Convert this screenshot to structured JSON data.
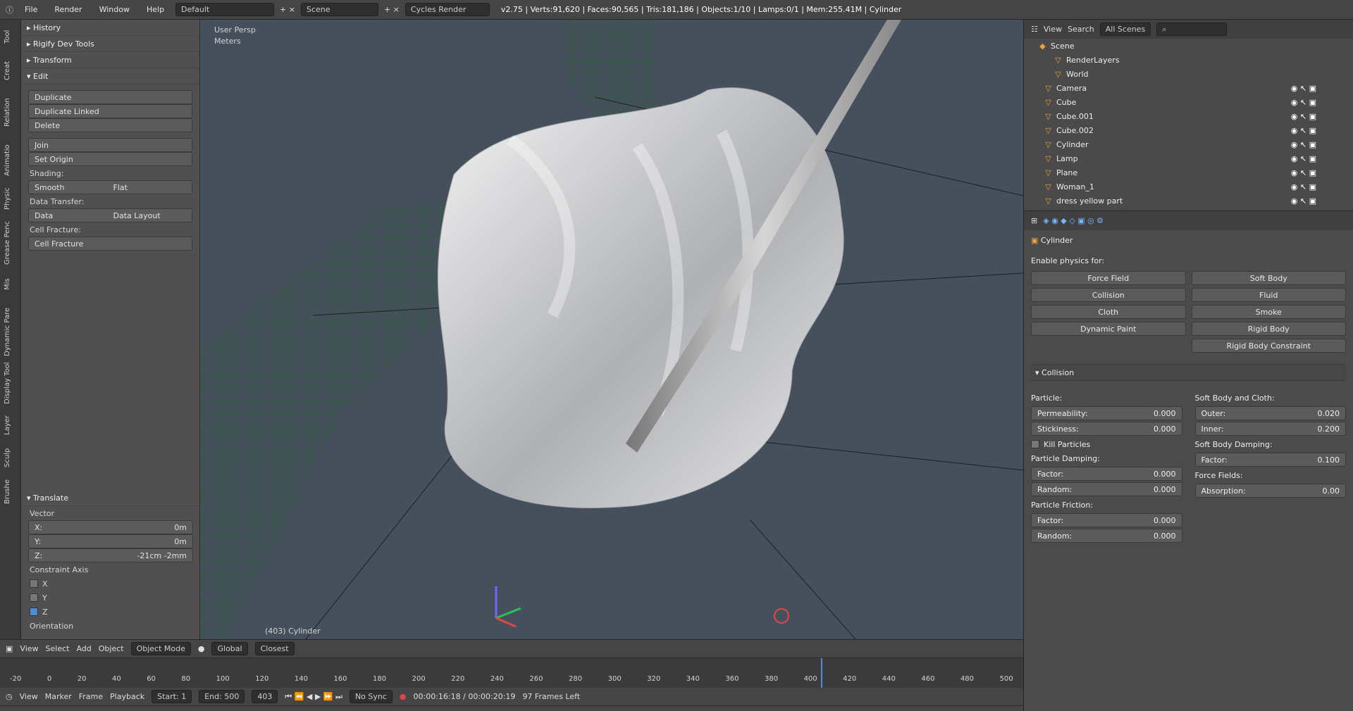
{
  "top": {
    "menus": [
      "File",
      "Render",
      "Window",
      "Help"
    ],
    "layout": "Default",
    "scene": "Scene",
    "engine": "Cycles Render",
    "stats": "v2.75 | Verts:91,620 | Faces:90,565 | Tris:181,186 | Objects:1/10 | Lamps:0/1 | Mem:255.41M | Cylinder"
  },
  "vtabs": [
    "Tool",
    "Creat",
    "Relation",
    "Animatio",
    "Physic",
    "Grease Penc",
    "Mis",
    "Dynamic Pare",
    "Display Tool",
    "Layer",
    "Sculp",
    "Brushe"
  ],
  "tool": {
    "history": "History",
    "rigify": "Rigify Dev Tools",
    "transform": "Transform",
    "edit": "Edit",
    "buttons": [
      "Duplicate",
      "Duplicate Linked",
      "Delete",
      "Join",
      "Set Origin"
    ],
    "shading": "Shading:",
    "smooth": "Smooth",
    "flat": "Flat",
    "data_transfer": "Data Transfer:",
    "data": "Data",
    "data_layout": "Data Layout",
    "cell_fracture_label": "Cell Fracture:",
    "cell_fracture": "Cell Fracture",
    "translate": "Translate",
    "vector": "Vector",
    "x": "X:",
    "y": "Y:",
    "z": "Z:",
    "xv": "0m",
    "yv": "0m",
    "zv": "-21cm -2mm",
    "constraint": "Constraint Axis",
    "axes": [
      "X",
      "Y",
      "Z"
    ],
    "orientation": "Orientation"
  },
  "viewport": {
    "persp": "User Persp",
    "units": "Meters",
    "object": "(403) Cylinder"
  },
  "view_header": [
    "View",
    "Select",
    "Add",
    "Object",
    "Object Mode",
    "Global",
    "Closest"
  ],
  "timeline": {
    "menus": [
      "View",
      "Marker",
      "Frame",
      "Playback"
    ],
    "start_label": "Start:",
    "start": "1",
    "end_label": "End:",
    "end": "500",
    "frame": "403",
    "sync": "No Sync",
    "time": "00:00:16:18 / 00:00:20:19",
    "frames_left": "97 Frames Left",
    "ticks": [
      "-20",
      "0",
      "20",
      "40",
      "60",
      "80",
      "100",
      "120",
      "140",
      "160",
      "180",
      "200",
      "220",
      "240",
      "260",
      "280",
      "300",
      "320",
      "340",
      "360",
      "380",
      "400",
      "420",
      "440",
      "460",
      "480",
      "500"
    ]
  },
  "outliner": {
    "view": "View",
    "search": "Search",
    "all_scenes": "All Scenes",
    "items": [
      "Scene",
      "RenderLayers",
      "World",
      "Camera",
      "Cube",
      "Cube.001",
      "Cube.002",
      "Cylinder",
      "Lamp",
      "Plane",
      "Woman_1",
      "dress yellow part"
    ]
  },
  "props": {
    "object": "Cylinder",
    "enable": "Enable physics for:",
    "buttons": [
      "Force Field",
      "Soft Body",
      "Collision",
      "Fluid",
      "Cloth",
      "Smoke",
      "Dynamic Paint",
      "Rigid Body",
      "",
      "Rigid Body Constraint"
    ],
    "collision": "Collision",
    "particle": "Particle:",
    "permeability": "Permeability:",
    "perm_v": "0.000",
    "stickiness": "Stickiness:",
    "stick_v": "0.000",
    "kill": "Kill Particles",
    "damping": "Particle Damping:",
    "factor": "Factor:",
    "factor_v": "0.000",
    "random": "Random:",
    "random_v": "0.000",
    "friction": "Particle Friction:",
    "ffactor_v": "0.000",
    "frandom_v": "0.000",
    "soft": "Soft Body and Cloth:",
    "outer": "Outer:",
    "outer_v": "0.020",
    "inner": "Inner:",
    "inner_v": "0.200",
    "sbd": "Soft Body Damping:",
    "sbd_factor_v": "0.100",
    "force_fields": "Force Fields:",
    "absorption": "Absorption:",
    "absorption_v": "0.00"
  }
}
